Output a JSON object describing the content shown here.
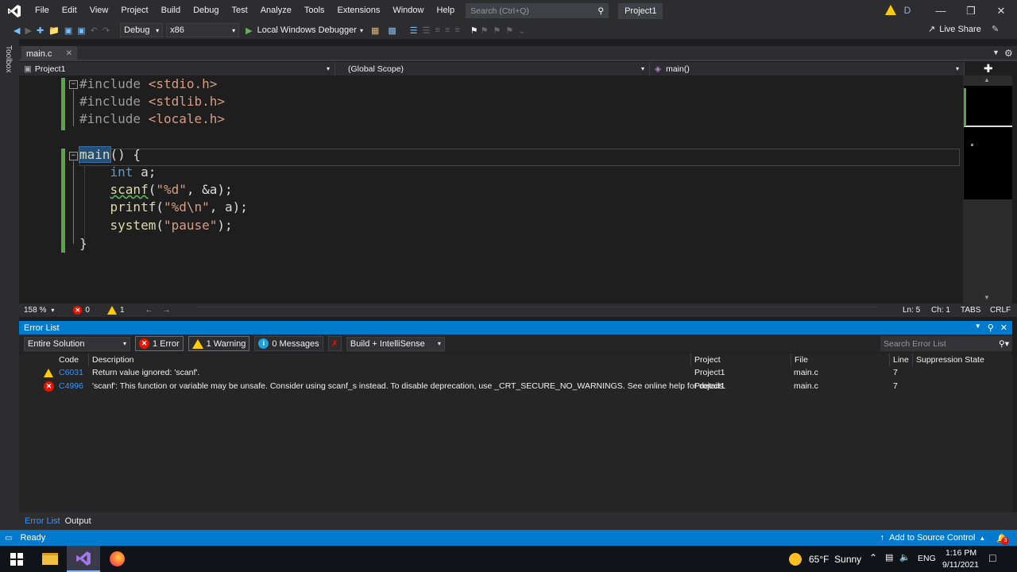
{
  "menu": [
    "File",
    "Edit",
    "View",
    "Project",
    "Build",
    "Debug",
    "Test",
    "Analyze",
    "Tools",
    "Extensions",
    "Window",
    "Help"
  ],
  "search": {
    "placeholder": "Search (Ctrl+Q)"
  },
  "window_title": "Project1",
  "user_initial": "D",
  "toolbar": {
    "config": "Debug",
    "platform": "x86",
    "run_label": "Local Windows Debugger",
    "live_share": "Live Share"
  },
  "toolbox_label": "Toolbox",
  "tab": {
    "name": "main.c"
  },
  "nav": {
    "project": "Project1",
    "scope": "(Global Scope)",
    "member": "main()"
  },
  "code_lines": [
    "#include <stdio.h>",
    "#include <stdlib.h>",
    "#include <locale.h>",
    "",
    "main() {",
    "    int a;",
    "    scanf(\"%d\", &a);",
    "    printf(\"%d\\n\", a);",
    "    system(\"pause\");",
    "}"
  ],
  "editor_status": {
    "zoom": "158 %",
    "errors": "0",
    "warnings": "1",
    "ln": "Ln: 5",
    "ch": "Ch: 1",
    "tabs": "TABS",
    "eol": "CRLF"
  },
  "error_list": {
    "title": "Error List",
    "scope": "Entire Solution",
    "errors_btn": "1 Error",
    "warnings_btn": "1 Warning",
    "messages_btn": "0 Messages",
    "build_filter": "Build + IntelliSense",
    "search_placeholder": "Search Error List",
    "columns": [
      "Code",
      "Description",
      "Project",
      "File",
      "Line",
      "Suppression State"
    ],
    "rows": [
      {
        "type": "warning",
        "code": "C6031",
        "description": "Return value ignored: 'scanf'.",
        "project": "Project1",
        "file": "main.c",
        "line": "7"
      },
      {
        "type": "error",
        "code": "C4996",
        "description": "'scanf': This function or variable may be unsafe. Consider using scanf_s instead. To disable deprecation, use _CRT_SECURE_NO_WARNINGS. See online help for details.",
        "project": "Project1",
        "file": "main.c",
        "line": "7"
      }
    ]
  },
  "bottom_tabs": [
    "Error List",
    "Output"
  ],
  "status": {
    "left": "Ready",
    "right": "Add to Source Control",
    "notif": "3"
  },
  "taskbar": {
    "weather": "65°F  Sunny",
    "lang": "ENG",
    "time": "1:16 PM",
    "date": "9/11/2021"
  },
  "colors": {
    "accent": "#007acc",
    "editor_bg": "#1e1e1e",
    "chrome_bg": "#2d2d30"
  }
}
